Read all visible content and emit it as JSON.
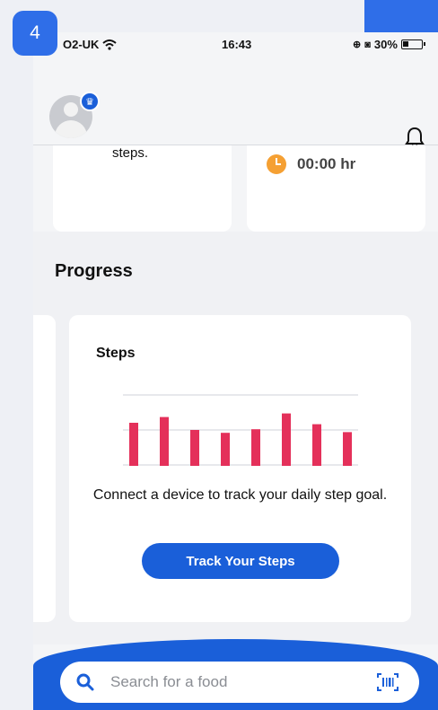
{
  "overlay": {
    "step_number": "4"
  },
  "status_bar": {
    "carrier": "O2-UK",
    "time": "16:43",
    "battery": "30%"
  },
  "cards": {
    "left_text": "steps.",
    "timer_value": "00:00 hr"
  },
  "progress": {
    "title": "Progress",
    "steps_card": {
      "title": "Steps",
      "description": "Connect a device to track your daily step goal.",
      "button_label": "Track Your Steps"
    }
  },
  "search": {
    "placeholder": "Search for a food"
  },
  "colors": {
    "accent": "#1a5fd9",
    "bar": "#e4305a",
    "timer": "#f5a033"
  },
  "chart_data": {
    "type": "bar",
    "values": [
      0.6,
      0.68,
      0.5,
      0.46,
      0.51,
      0.73,
      0.58,
      0.47
    ]
  }
}
